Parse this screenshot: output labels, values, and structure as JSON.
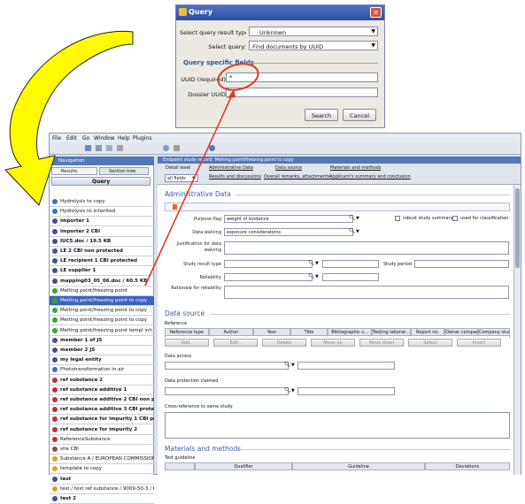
{
  "dialog": {
    "title": "Query",
    "result_type_label": "Select query result type:",
    "result_type_value": "Unknown",
    "query_label": "Select query:",
    "query_value": "Find documents by UUID",
    "specific_fields_label": "Query specific fields",
    "uuid_label": "UUID (required)",
    "uuid_value": "*",
    "dossier_label": "Dossier UUID",
    "search_label": "Search",
    "cancel_label": "Cancel"
  },
  "menu": [
    "File",
    "Edit",
    "Go",
    "Window",
    "Help",
    "Plugins"
  ],
  "left": {
    "title": "Navigation",
    "tab_results": "Results",
    "tab_section": "Section tree",
    "query_header": "Query",
    "items": [
      {
        "label": "Hydrolysis to copy",
        "bold": false,
        "color": "#3a6fd0"
      },
      {
        "label": "Hydrolysis to inherited",
        "bold": false,
        "color": "#3a6fd0"
      },
      {
        "label": "importer 1",
        "bold": true,
        "color": "#4a4a9a"
      },
      {
        "label": "importer 2 CBI",
        "bold": true,
        "color": "#4a4a9a"
      },
      {
        "label": "IUC5.doc / 19.5 KB",
        "bold": true,
        "color": "#4a4a9a"
      },
      {
        "label": "LE 2 CBI non protected",
        "bold": true,
        "color": "#4a4a9a"
      },
      {
        "label": "LE recipient 1 CBI protected",
        "bold": true,
        "color": "#4a4a9a"
      },
      {
        "label": "LE supplier 1",
        "bold": true,
        "color": "#4a4a9a"
      },
      {
        "label": "mapping03_05_06.doc / 60.5 KB",
        "bold": true,
        "color": "#4a4a9a"
      },
      {
        "label": "Melting point/freezing point",
        "bold": false,
        "color": "#33aa33"
      },
      {
        "label": "Melting point/freezing point to copy",
        "bold": false,
        "color": "#33aa33",
        "selected": true
      },
      {
        "label": "Melting point/freezing point to copy",
        "bold": false,
        "color": "#33aa33"
      },
      {
        "label": "Melting point/freezing point to copy",
        "bold": false,
        "color": "#33aa33"
      },
      {
        "label": "Melting point/freezing point templ inh",
        "bold": false,
        "color": "#33aa33"
      },
      {
        "label": "member 1 of JS",
        "bold": true,
        "color": "#4a4a9a"
      },
      {
        "label": "member 2 JS",
        "bold": true,
        "color": "#4a4a9a"
      },
      {
        "label": "my legal entity",
        "bold": true,
        "color": "#4a4a9a"
      },
      {
        "label": "Phototransformation in air",
        "bold": false,
        "color": "#3a6fd0"
      },
      {
        "label": "ref substance 2",
        "bold": true,
        "color": "#c03030"
      },
      {
        "label": "ref substance additive 1",
        "bold": true,
        "color": "#c03030"
      },
      {
        "label": "ref substance additive 2 CBI non pro",
        "bold": true,
        "color": "#c03030"
      },
      {
        "label": "ref substance additive 3 CBI protect",
        "bold": true,
        "color": "#c03030"
      },
      {
        "label": "ref substance for impurity 1 CBI prote",
        "bold": true,
        "color": "#c03030"
      },
      {
        "label": "ref substance for impurity 2",
        "bold": true,
        "color": "#c03030"
      },
      {
        "label": "ReferenceSubstance",
        "bold": false,
        "color": "#c03030"
      },
      {
        "label": "site CBI",
        "bold": false,
        "color": "#7a5a3a"
      },
      {
        "label": "Substance A / EUROPEAN COMMISSION -",
        "bold": false,
        "color": "#e0a020"
      },
      {
        "label": "template to copy",
        "bold": false,
        "color": "#e0a020"
      },
      {
        "label": "test",
        "bold": true,
        "color": "#4a4a9a"
      },
      {
        "label": "test / test ref substance / 9009-50-3 / E",
        "bold": false,
        "color": "#e0a020"
      },
      {
        "label": "test 2",
        "bold": true,
        "color": "#4a4a9a"
      }
    ]
  },
  "record": {
    "title": "Endpoint study record: Melting point/freezing point to copy",
    "detail_level_label": "Detail level",
    "detail_level_value": "all fields",
    "nav_links": [
      "Administrative Data",
      "Data source",
      "Materials and methods",
      "Results and discussions",
      "Overall remarks, attachments",
      "Applicant's summary and conclusion"
    ],
    "admin_title": "Administrative Data",
    "purpose_flag_label": "Purpose flag",
    "purpose_flag_value": "weight of evidence",
    "robust_label": "robust study summary",
    "classification_label": "used for classification",
    "data_waiving_label": "Data waiving",
    "data_waiving_value": "exposure considerations",
    "justification_label": "Justification for data waiving",
    "study_result_label": "Study result type",
    "study_period_label": "Study period",
    "reliability_label": "Reliability",
    "rationale_label": "Rationale for reliability",
    "data_source_title": "Data source",
    "reference_label": "Reference",
    "ref_columns": [
      "Reference type",
      "Author",
      "Year",
      "Title",
      "Bibliographic s...",
      "Testing laborat...",
      "Report no.",
      "Owner company",
      "Company study..."
    ],
    "ref_buttons": [
      "Add..",
      "Edit..",
      "Delete",
      "Move up",
      "Move down",
      "Select",
      "Insert"
    ],
    "data_access_label": "Data access",
    "data_protection_label": "Data protection claimed",
    "cross_ref_label": "Cross-reference to same study",
    "materials_title": "Materials and methods",
    "test_guideline_label": "Test guideline",
    "guideline_columns": [
      "Qualifier",
      "Guideline",
      "Deviations"
    ]
  },
  "colors": {
    "accent": "#3b63c0",
    "annotation": "#e8362a",
    "arrow_fill": "#fffa00"
  }
}
